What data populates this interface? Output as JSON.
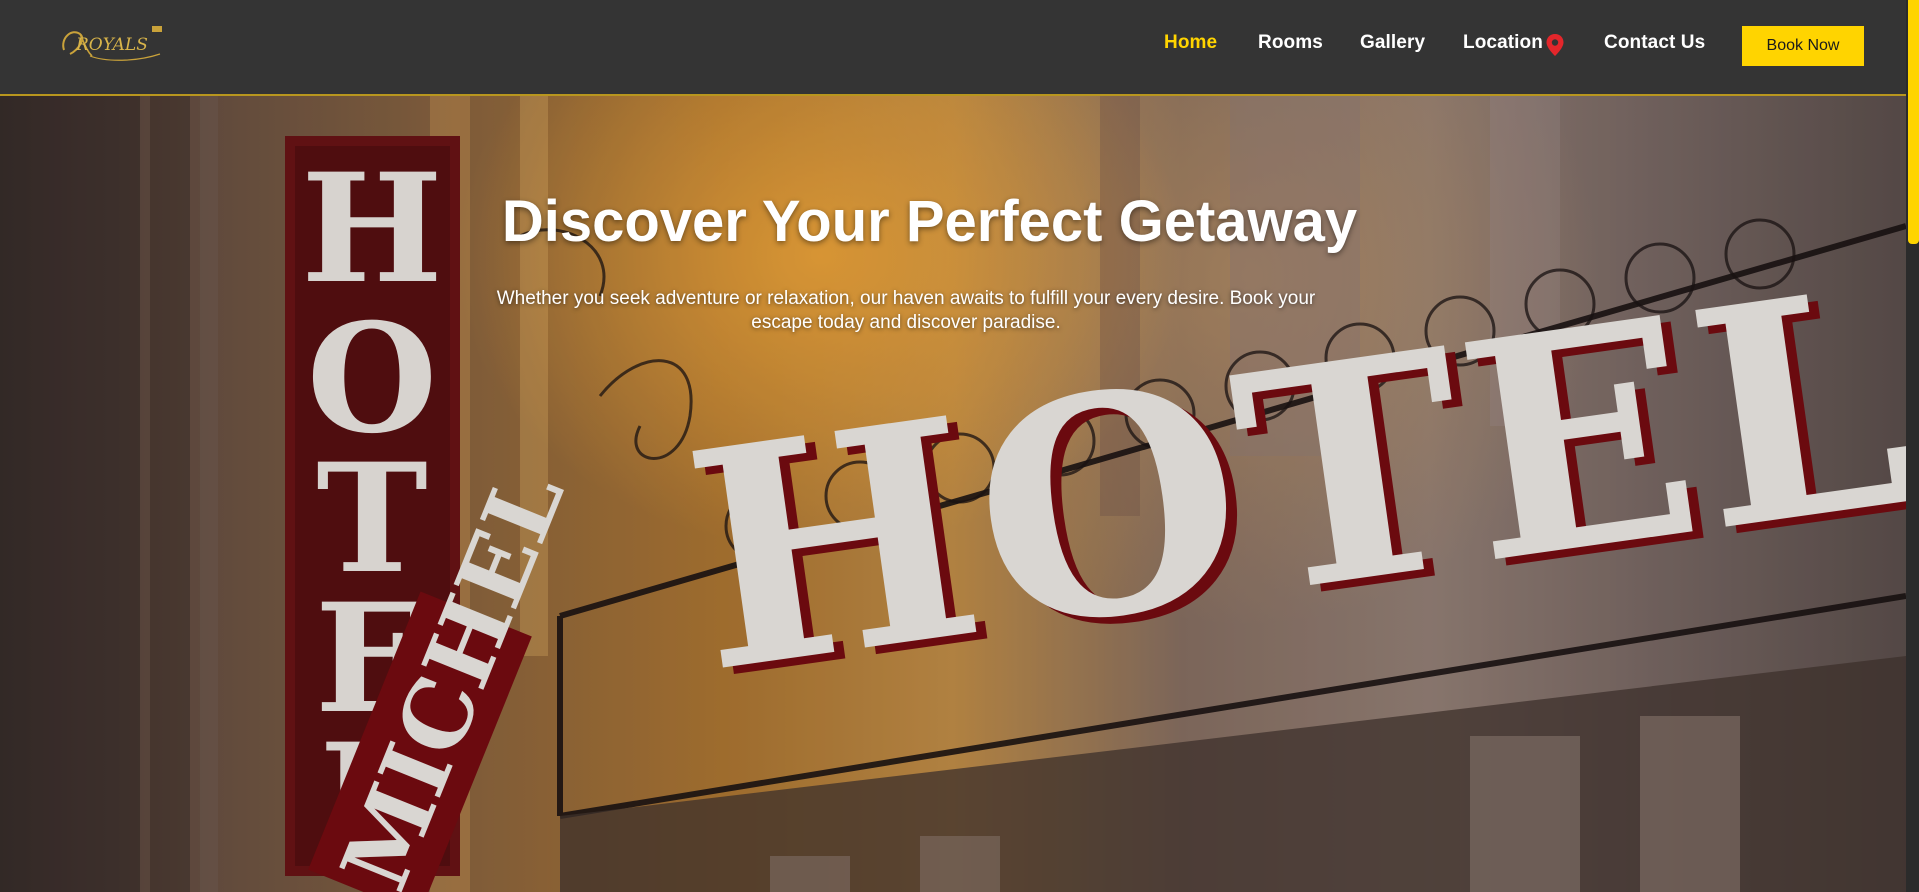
{
  "brand": {
    "logo_text": "ROYALS"
  },
  "nav": {
    "home": "Home",
    "rooms": "Rooms",
    "gallery": "Gallery",
    "location": "Location",
    "contact": "Contact Us",
    "book": "Book Now",
    "active": "Home"
  },
  "hero": {
    "title": "Discover Your Perfect Getaway",
    "subtitle": "Whether you seek adventure or relaxation, our haven awaits to fulfill your every desire. Book your escape today and discover paradise.",
    "sign_vertical": "HOTEL",
    "sign_horizontal": "HOTEL",
    "sign_side": "MICHEL"
  },
  "colors": {
    "accent": "#ffd400",
    "navbar": "#343434",
    "pin": "#e3262b"
  },
  "icons": {
    "location": "map-pin-icon"
  }
}
